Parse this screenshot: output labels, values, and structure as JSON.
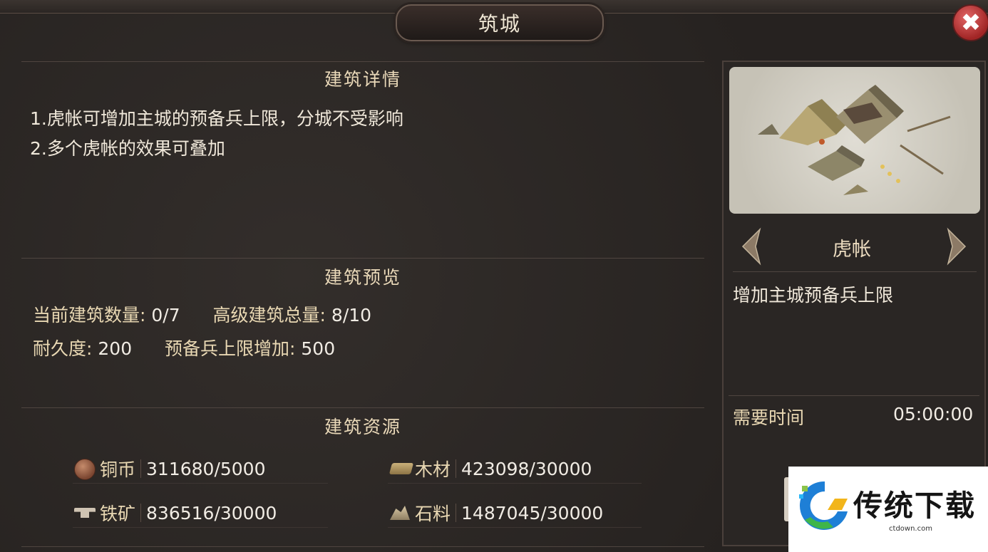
{
  "window": {
    "title": "筑城",
    "close_label": "✖"
  },
  "details": {
    "heading": "建筑详情",
    "lines": [
      "1.虎帐可增加主城的预备兵上限，分城不受影响",
      "2.多个虎帐的效果可叠加"
    ]
  },
  "preview_section": {
    "heading": "建筑预览",
    "current_count_label": "当前建筑数量:",
    "current_count_value": "0/7",
    "advanced_total_label": "高级建筑总量:",
    "advanced_total_value": "8/10",
    "durability_label": "耐久度:",
    "durability_value": "200",
    "reserve_label": "预备兵上限增加:",
    "reserve_value": "500"
  },
  "resources": {
    "heading": "建筑资源",
    "items": [
      {
        "icon": "copper-coin-icon",
        "label": "铜币",
        "value": "311680/5000"
      },
      {
        "icon": "wood-icon",
        "label": "木材",
        "value": "423098/30000"
      },
      {
        "icon": "iron-ore-icon",
        "label": "铁矿",
        "value": "836516/30000"
      },
      {
        "icon": "stone-icon",
        "label": "石料",
        "value": "1487045/30000"
      }
    ]
  },
  "building": {
    "name": "虎帐",
    "description": "增加主城预备兵上限",
    "time_label": "需要时间",
    "time_value": "05:00:00"
  },
  "watermark": {
    "brand": "传统下载",
    "url": "ctdown.com"
  },
  "colors": {
    "background": "#2a2624",
    "title_text": "#efe6d4",
    "label_gold": "#e9d8b3",
    "close_red": "#c03838"
  }
}
